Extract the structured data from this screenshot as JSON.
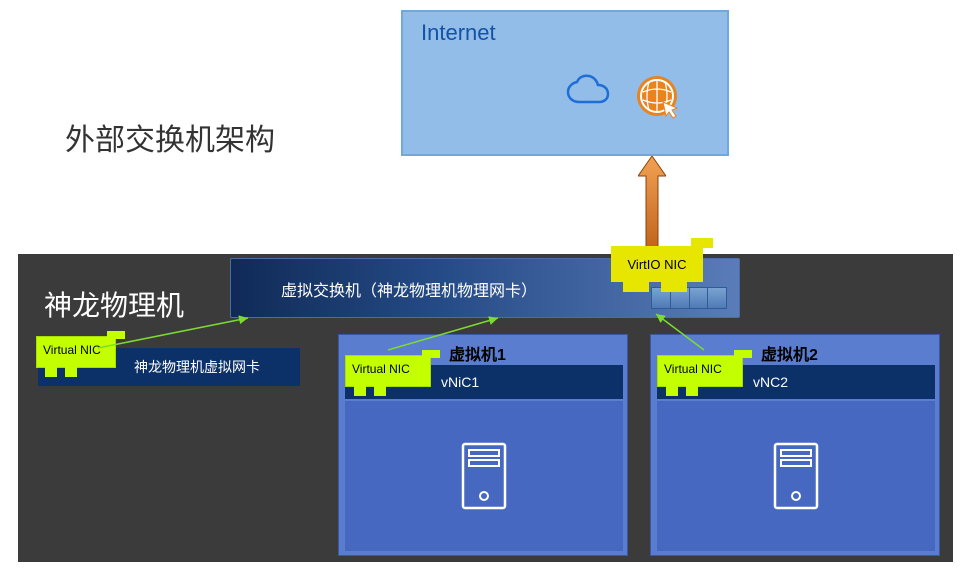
{
  "title": "外部交换机架构",
  "internet": {
    "label": "Internet"
  },
  "virtio_nic": {
    "label": "VirtIO NIC"
  },
  "host": {
    "label": "神龙物理机",
    "vswitch_label": "虚拟交换机（神龙物理机物理网卡）",
    "host_vnic_label": "神龙物理机虚拟网卡",
    "virtual_nic_badge": "Virtual NIC"
  },
  "vms": [
    {
      "title": "虚拟机1",
      "vnic": "vNiC1",
      "badge": "Virtual NIC"
    },
    {
      "title": "虚拟机2",
      "vnic": "vNC2",
      "badge": "Virtual NIC"
    }
  ]
}
